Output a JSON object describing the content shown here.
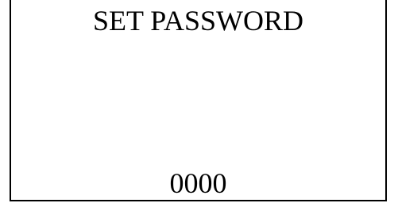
{
  "screen": {
    "title": "SET PASSWORD",
    "password_value": "0000"
  },
  "colors": {
    "background": "#ffffff",
    "border": "#000000",
    "text": "#000000"
  }
}
